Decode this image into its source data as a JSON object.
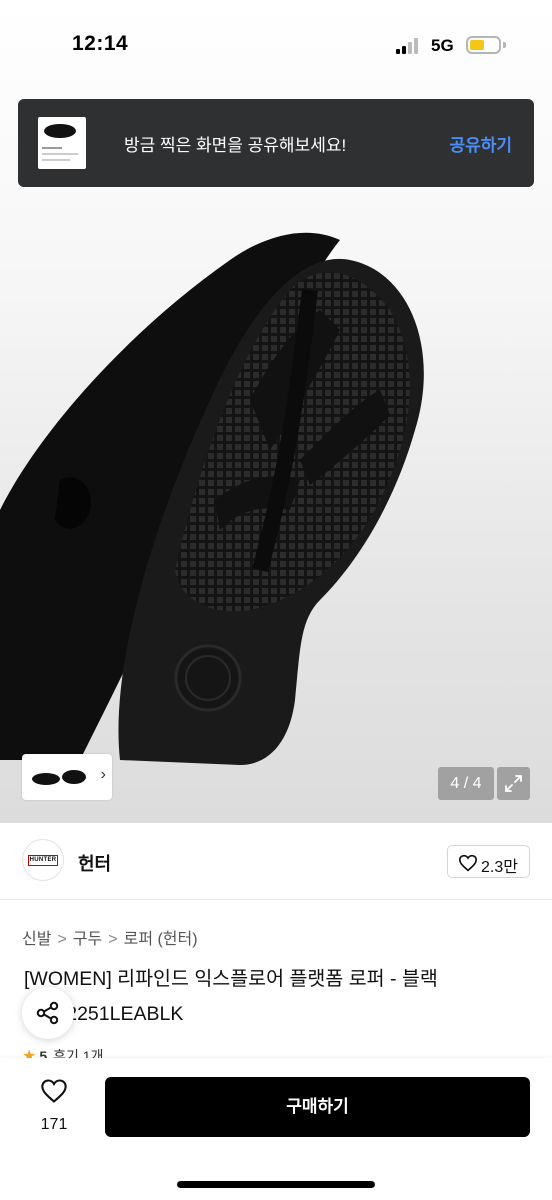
{
  "status_bar": {
    "time": "12:14",
    "network": "5G",
    "battery_color": "#f5c518"
  },
  "share_toast": {
    "message": "방금 찍은 화면을 공유해보세요!",
    "action_label": "공유하기",
    "action_color": "#4b8df8"
  },
  "gallery": {
    "page_indicator": "4 / 4",
    "thumb_chevron_icon": "chevron-right-icon",
    "expand_icon": "expand-icon"
  },
  "brand": {
    "logo_text": "HUNTER",
    "name": "헌터",
    "like_count": "2.3만",
    "like_icon": "heart-outline-icon"
  },
  "breadcrumb": [
    "신발",
    "구두",
    "로퍼 (헌터)"
  ],
  "product": {
    "title": "[WOMEN] 리파인드 익스플로어 플랫폼 로퍼 - 블랙 WFF2251LEABLK",
    "rating": "5",
    "review_text": "후기 1개"
  },
  "bottom_bar": {
    "wish_count": "171",
    "buy_label": "구매하기",
    "buy_color": "#000000"
  }
}
